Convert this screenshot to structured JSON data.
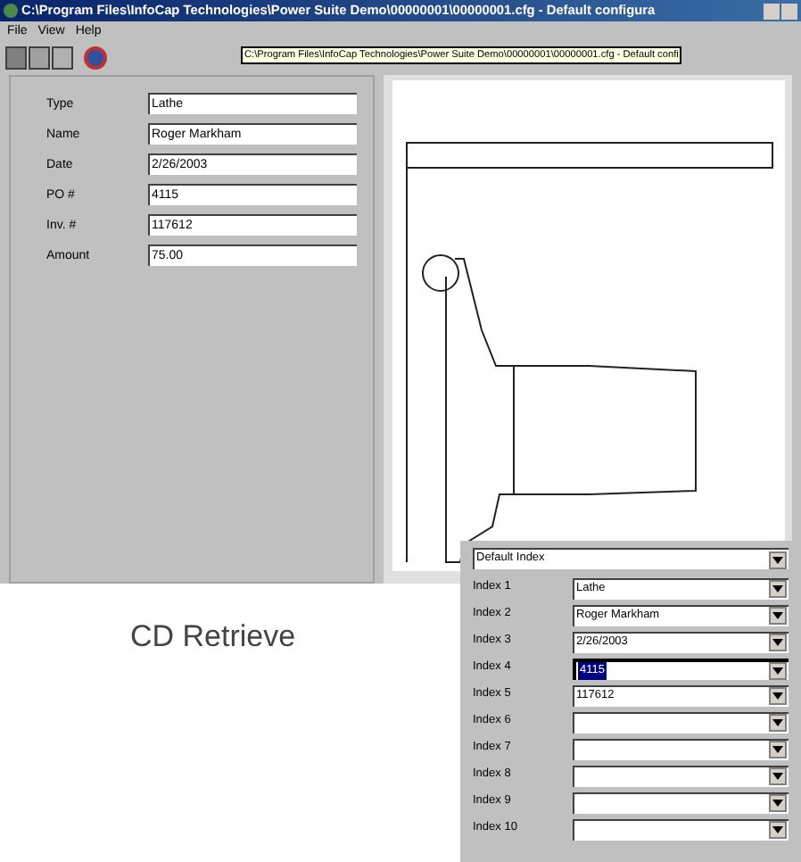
{
  "window": {
    "title": "C:\\Program Files\\InfoCap Technologies\\Power Suite Demo\\00000001\\00000001.cfg - Default configura"
  },
  "menu": [
    "File",
    "View",
    "Help"
  ],
  "tooltip": "C:\\Program Files\\InfoCap Technologies\\Power Suite Demo\\00000001\\00000001.cfg - Default confi",
  "fields": [
    {
      "label": "Type",
      "value": "Lathe"
    },
    {
      "label": "Name",
      "value": "Roger Markham"
    },
    {
      "label": "Date",
      "value": "2/26/2003"
    },
    {
      "label": "PO #",
      "value": "4115"
    },
    {
      "label": "Inv. #",
      "value": "117612"
    },
    {
      "label": "Amount",
      "value": "75.00"
    }
  ],
  "index_panel": {
    "index_set": "Default Index",
    "indexes": [
      {
        "label": "Index 1",
        "value": "Lathe",
        "selected": false
      },
      {
        "label": "Index 2",
        "value": "Roger Markham",
        "selected": false
      },
      {
        "label": "Index 3",
        "value": "2/26/2003",
        "selected": false
      },
      {
        "label": "Index 4",
        "value": "4115",
        "selected": true
      },
      {
        "label": "Index 5",
        "value": "117612",
        "selected": false
      },
      {
        "label": "Index 6",
        "selected": false
      },
      {
        "label": "Index 7",
        "selected": false
      },
      {
        "label": "Index 8",
        "selected": false
      },
      {
        "label": "Index 9",
        "selected": false
      },
      {
        "label": "Index 10",
        "selected": false
      }
    ]
  },
  "caption": "CD Retrieve"
}
